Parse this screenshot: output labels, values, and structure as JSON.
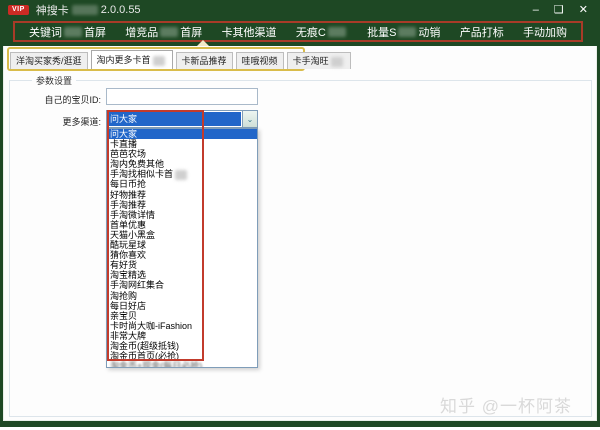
{
  "window": {
    "vip_badge": "VIP",
    "title_prefix": "神搜卡",
    "title_suffix": "2.0.0.55",
    "controls": {
      "minimize": "–",
      "maximize": "❑",
      "close": "✕"
    }
  },
  "menu": {
    "items": [
      {
        "pre": "关键词",
        "censored": true,
        "post": "首屏"
      },
      {
        "pre": "增竞品",
        "censored": true,
        "post": "首屏"
      },
      {
        "pre": "卡其他渠道",
        "censored": false,
        "post": "",
        "active": true
      },
      {
        "pre": "无痕C",
        "censored": true,
        "post": ""
      },
      {
        "pre": "批量S",
        "censored": true,
        "post": "动销"
      },
      {
        "pre": "产品打标",
        "censored": false,
        "post": ""
      },
      {
        "pre": "手动加购",
        "censored": false,
        "post": ""
      }
    ]
  },
  "tabs": {
    "items": [
      {
        "label": "洋淘买家秀/逛逛",
        "censored": false,
        "active": false
      },
      {
        "label": "淘内更多卡首",
        "censored": true,
        "active": true
      },
      {
        "label": "卡新品推荐",
        "censored": false,
        "active": false
      },
      {
        "label": "哇哦视频",
        "censored": false,
        "active": false
      },
      {
        "label": "卡手淘旺",
        "censored": true,
        "active": false
      }
    ]
  },
  "panel": {
    "group_label": "参数设置",
    "item_id_label": "自己的宝贝ID:",
    "item_id_value": "",
    "channel_label": "更多渠道:",
    "channel_selected": "问大家"
  },
  "dropdown": {
    "items": [
      {
        "label": "问大家",
        "selected": true
      },
      {
        "label": "卡直播"
      },
      {
        "label": "芭芭农场"
      },
      {
        "label": "淘内免费其他"
      },
      {
        "label": "手淘找相似卡首",
        "censored": true
      },
      {
        "label": "每日币抢"
      },
      {
        "label": "好物推荐"
      },
      {
        "label": "手淘推荐"
      },
      {
        "label": "手淘微详情"
      },
      {
        "label": "首单优惠"
      },
      {
        "label": "天猫小黑盒"
      },
      {
        "label": "酷玩星球"
      },
      {
        "label": "猜你喜欢"
      },
      {
        "label": "有好货"
      },
      {
        "label": "淘宝精选"
      },
      {
        "label": "手淘网红集合"
      },
      {
        "label": "淘抢购"
      },
      {
        "label": "每日好店"
      },
      {
        "label": "亲宝贝"
      },
      {
        "label": "卡时尚大咖-iFashion"
      },
      {
        "label": "非常大牌"
      },
      {
        "label": "淘金币(超级抵钱)"
      },
      {
        "label": "淘金币首页(必抢)"
      },
      {
        "label": "淘金币+现金(每日必抢)",
        "clipped": true
      }
    ]
  },
  "watermark": "知乎 @一杯阿茶",
  "colors": {
    "frame_green": "#1e4824",
    "annotation_red": "#a83b28",
    "annotation_red_inner": "#c23b2c",
    "annotation_yellow": "#d9bc4a",
    "selection_blue": "#2166c9",
    "vip_red": "#cc2b24"
  }
}
